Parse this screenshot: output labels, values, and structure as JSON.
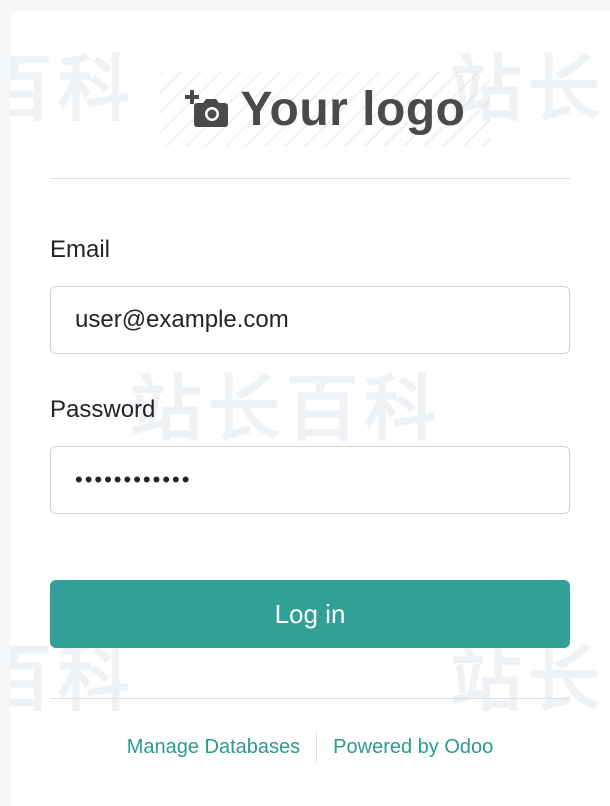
{
  "logo": {
    "icon": "camera-plus-icon",
    "text": "Your logo"
  },
  "form": {
    "email_label": "Email",
    "email_value": "user@example.com",
    "password_label": "Password",
    "password_value": "demopassword",
    "submit_label": "Log in"
  },
  "footer": {
    "manage_databases": "Manage Databases",
    "powered_by": "Powered by Odoo"
  },
  "colors": {
    "accent": "#31a097",
    "link": "#2b9a90",
    "text": "#212529",
    "logo_text": "#4a4a4a"
  }
}
